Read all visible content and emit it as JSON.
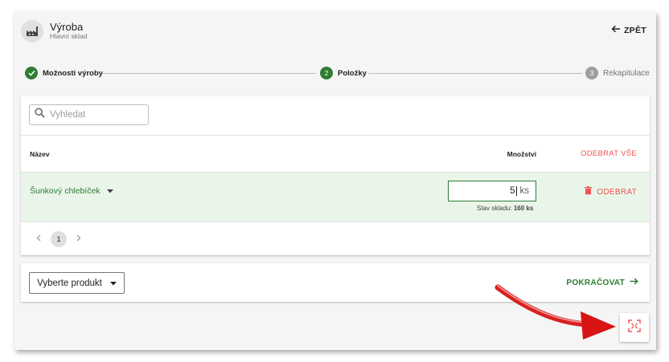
{
  "header": {
    "title": "Výroba",
    "subtitle": "Hlavní sklad",
    "icon": "factory-icon",
    "back_label": "ZPĚT"
  },
  "stepper": {
    "steps": [
      {
        "number": "1",
        "label": "Možnosti výroby",
        "state": "completed"
      },
      {
        "number": "2",
        "label": "Položky",
        "state": "active"
      },
      {
        "number": "3",
        "label": "Rekapitulace",
        "state": "upcoming"
      }
    ]
  },
  "search": {
    "placeholder": "Vyhledat",
    "value": ""
  },
  "table": {
    "columns": {
      "name": "Název",
      "quantity": "Množství",
      "remove_all": "ODEBRAT VŠE"
    },
    "rows": [
      {
        "product": "Šunkový chlebíček",
        "quantity": "5",
        "unit": "ks",
        "stock_label": "Stav skladu:",
        "stock_value": "160 ks",
        "remove_label": "ODEBRAT"
      }
    ]
  },
  "pagination": {
    "current_page": "1"
  },
  "footer": {
    "select_label": "Vyberte produkt",
    "continue_label": "POKRAČOVAT"
  },
  "colors": {
    "accent_green": "#2e7d32",
    "danger_red": "#ef5350",
    "row_highlight": "#eaf5ea",
    "annotation_arrow": "#e11b1b"
  }
}
